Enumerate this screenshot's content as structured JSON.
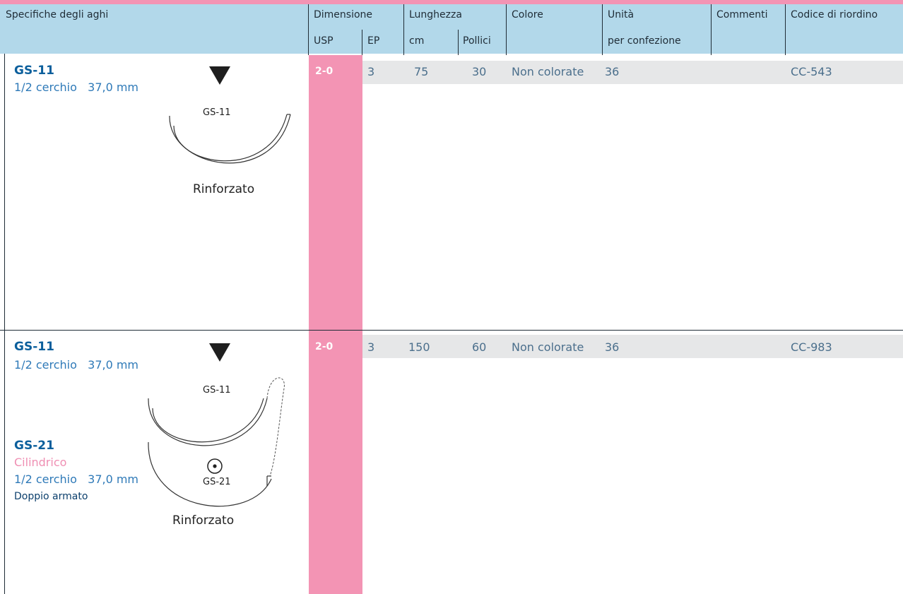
{
  "header": {
    "spec": "Specifiche degli aghi",
    "dimension": "Dimensione",
    "usp": "USP",
    "ep": "EP",
    "length": "Lunghezza",
    "cm": "cm",
    "inches": "Pollici",
    "color": "Colore",
    "units": "Unità",
    "per_pack": "per confezione",
    "comments": "Commenti",
    "reorder": "Codice di riordino"
  },
  "rows": [
    {
      "needle": "GS-11",
      "shape": "1/2 cerchio   37,0 mm",
      "icon_label": "GS-11",
      "reinforced": "Rinforzato",
      "usp": "2-0",
      "ep": "3",
      "cm": "75",
      "inches": "30",
      "color": "Non colorate",
      "units": "36",
      "comments": "",
      "code": "CC-543"
    },
    {
      "needle": "GS-11",
      "shape": "1/2 cerchio   37,0 mm",
      "icon_label": "GS-11",
      "needle2": "GS-21",
      "needle2_type": "Cilindrico",
      "shape2": "1/2 cerchio   37,0 mm",
      "double": "Doppio armato",
      "icon_label2": "GS-21",
      "reinforced": "Rinforzato",
      "usp": "2-0",
      "ep": "3",
      "cm": "150",
      "inches": "60",
      "color": "Non colorate",
      "units": "36",
      "comments": "",
      "code": "CC-983"
    }
  ],
  "icons": [
    "cutting-triangle-icon",
    "taper-point-icon",
    "needle-curve-icon"
  ],
  "colors": {
    "accent_pink": "#f394b4",
    "header_blue": "#b2d8ea",
    "row_gray": "#e6e7e8",
    "title_blue": "#0b5f9c"
  }
}
